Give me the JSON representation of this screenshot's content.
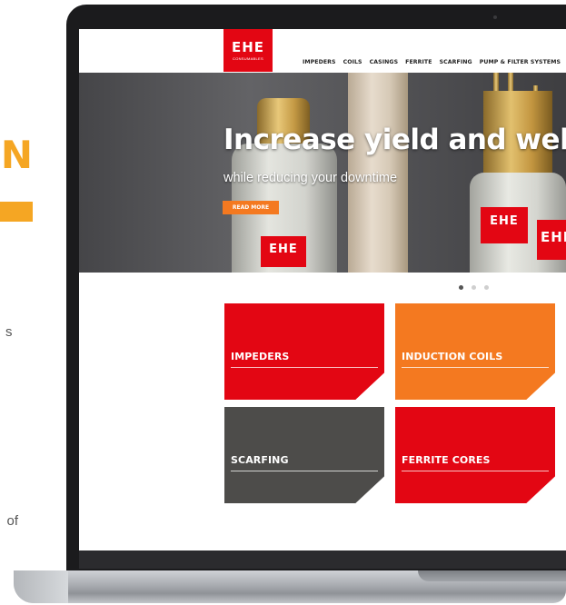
{
  "background_page": {
    "heading_fragment": "N",
    "text_fragment_1": "s",
    "text_fragment_2": "of"
  },
  "site": {
    "logo": {
      "main": "EHE",
      "sub": "CONSUMABLES"
    },
    "nav": [
      "IMPEDERS",
      "COILS",
      "CASINGS",
      "FERRITE",
      "SCARFING",
      "PUMP & FILTER SYSTEMS"
    ],
    "hero": {
      "title": "Increase yield and weld",
      "subtitle": "while reducing your downtime",
      "cta": "READ MORE",
      "product_label": "EHE"
    },
    "carousel": {
      "slide_count": 3,
      "active_index": 0
    },
    "tiles": [
      {
        "label": "IMPEDERS",
        "color": "#e30613"
      },
      {
        "label": "INDUCTION COILS",
        "color": "#f47920"
      },
      {
        "label": "SCARFING",
        "color": "#4d4c4a"
      },
      {
        "label": "FERRITE CORES",
        "color": "#e30613"
      }
    ]
  },
  "colors": {
    "brand_red": "#e30613",
    "brand_orange": "#f47920",
    "accent_yellow": "#f5a623",
    "laptop_frame": "#1b1b1d"
  }
}
